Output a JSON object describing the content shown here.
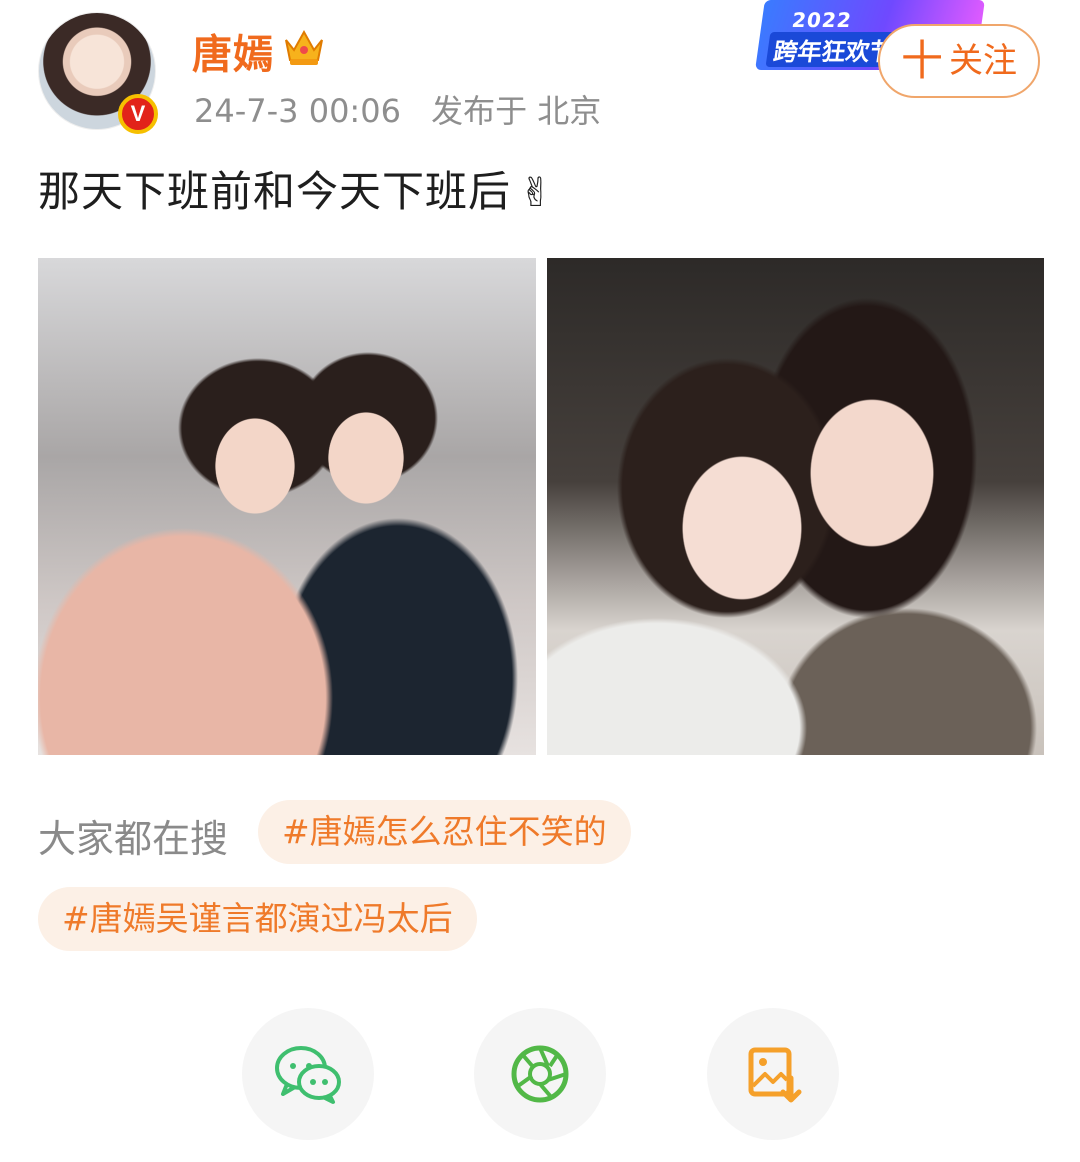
{
  "user": {
    "name": "唐嫣",
    "verified_badge": "V",
    "timestamp": "24-7-3 00:06",
    "location": "发布于 北京"
  },
  "event_banner": {
    "year": "2022",
    "name": "跨年狂欢节"
  },
  "follow_button": {
    "plus": "十",
    "label": "关注"
  },
  "post": {
    "text": "那天下班前和今天下班后",
    "emoji": "✌"
  },
  "photos": [
    {
      "icon": "photo-1"
    },
    {
      "icon": "photo-2"
    }
  ],
  "search": {
    "label": "大家都在搜",
    "tags": [
      "#唐嫣怎么忍住不笑的",
      "#唐嫣吴谨言都演过冯太后"
    ]
  },
  "share": [
    {
      "icon": "wechat-icon"
    },
    {
      "icon": "moments-icon"
    },
    {
      "icon": "save-image-icon"
    }
  ],
  "colors": {
    "accent": "#f06a1d",
    "tag_bg": "#fcf0e6",
    "tag_text": "#ef7a2a",
    "meta_text": "#8e8e8e",
    "wechat_green": "#3fbf6f",
    "save_orange": "#f5a02a"
  }
}
